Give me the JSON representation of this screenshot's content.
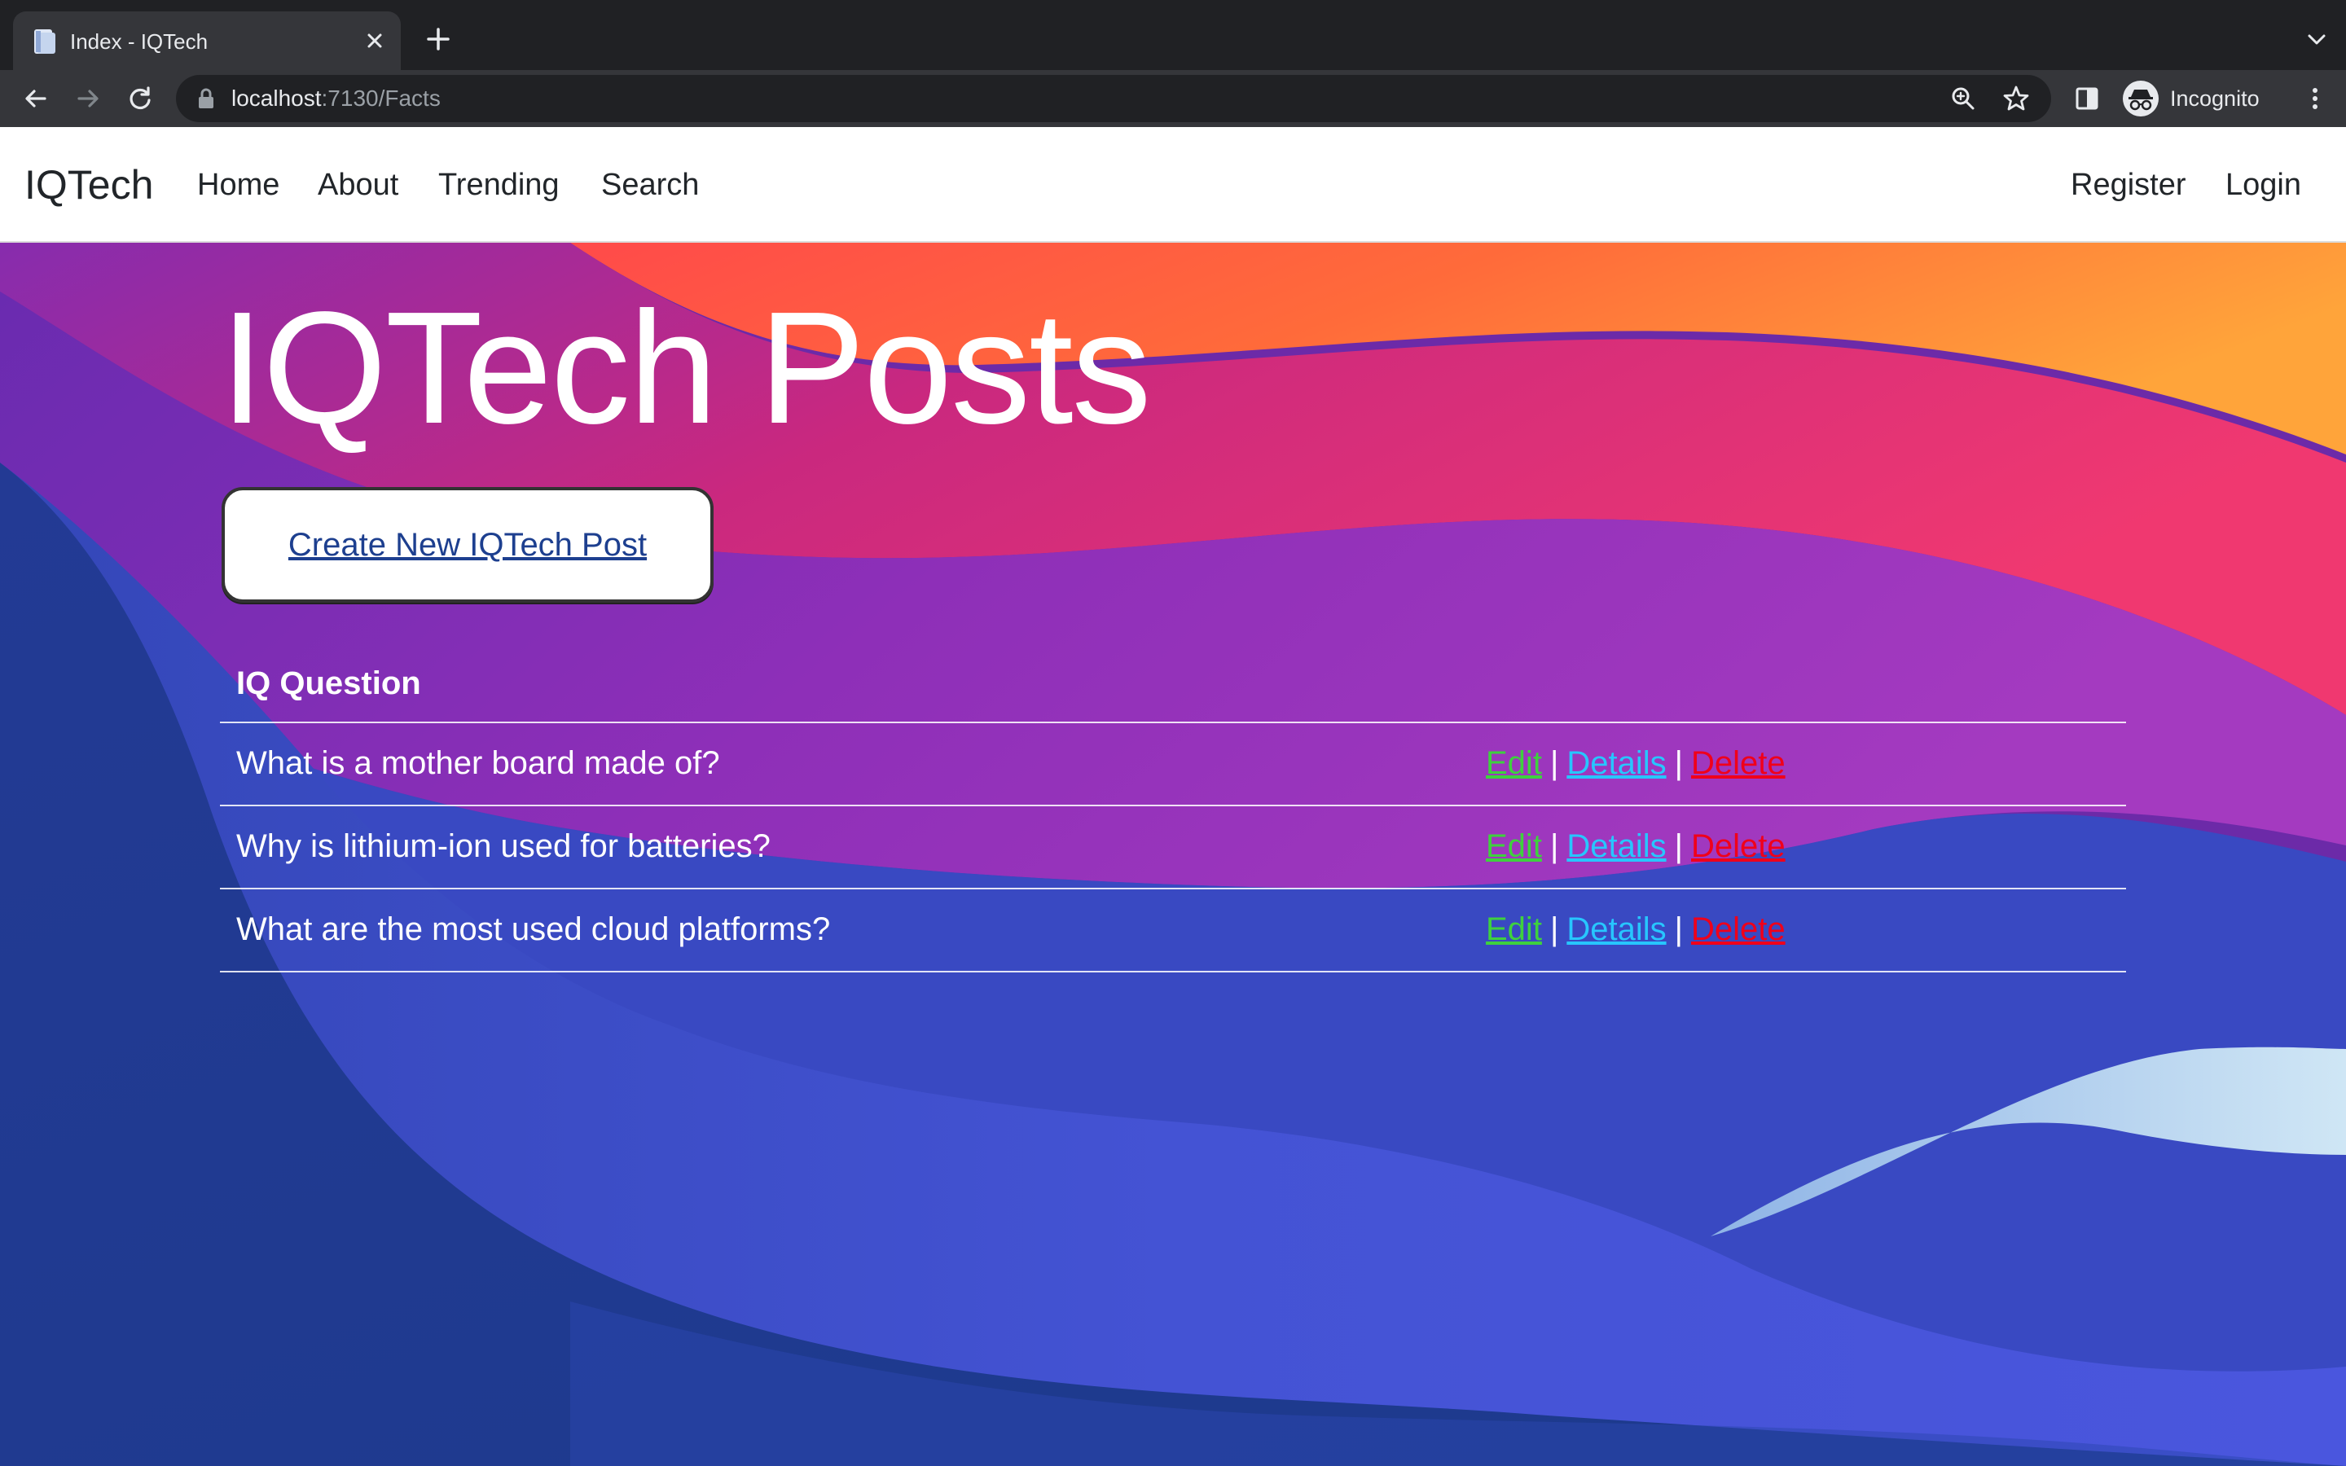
{
  "browser": {
    "tab_title": "Index - IQTech",
    "url_host": "localhost",
    "url_path": ":7130/Facts",
    "profile_label": "Incognito"
  },
  "navbar": {
    "brand": "IQTech",
    "links": [
      "Home",
      "About",
      "Trending",
      "Search"
    ],
    "right_links": [
      "Register",
      "Login"
    ]
  },
  "main": {
    "heading": "IQTech Posts",
    "create_label": "Create New IQTech Post",
    "table_header": "IQ Question",
    "rows": [
      {
        "question": "What is a mother board made of?"
      },
      {
        "question": "Why is lithium-ion used for batteries?"
      },
      {
        "question": "What are the most used cloud platforms?"
      }
    ],
    "actions": {
      "edit": "Edit",
      "details": "Details",
      "delete": "Delete",
      "separator": "|"
    }
  },
  "colors": {
    "edit": "#3ed13e",
    "details": "#27c6ff",
    "delete": "#f0001a",
    "create_link": "#1d3f8f"
  },
  "icons": {
    "browser": [
      "favicon-icon",
      "tab-close-icon",
      "new-tab-icon",
      "tab-search-icon",
      "back-icon",
      "forward-icon",
      "reload-icon",
      "lock-icon",
      "zoom-icon",
      "bookmark-star-icon",
      "side-panel-icon",
      "incognito-icon",
      "menu-icon"
    ]
  }
}
